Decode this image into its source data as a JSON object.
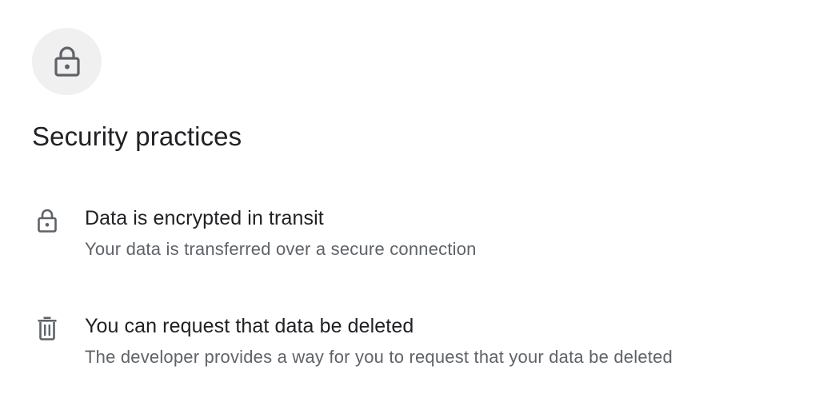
{
  "header": {
    "icon": "lock-icon",
    "title": "Security practices"
  },
  "practices": [
    {
      "icon": "lock-icon",
      "title": "Data is encrypted in transit",
      "description": "Your data is transferred over a secure connection"
    },
    {
      "icon": "trash-icon",
      "title": "You can request that data be deleted",
      "description": "The developer provides a way for you to request that your data be deleted"
    }
  ],
  "colors": {
    "title_text": "#202124",
    "secondary_text": "#5f6368",
    "icon": "#5f6368",
    "icon_circle_bg": "#f0f0f0",
    "background": "#ffffff"
  }
}
